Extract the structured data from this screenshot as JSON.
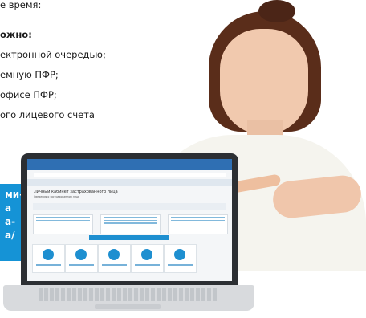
{
  "text_lines": [
    {
      "text": "е время:",
      "bold": false
    },
    {
      "text": "ожно:",
      "bold": true
    },
    {
      "text": "ектронной очередью;",
      "bold": false
    },
    {
      "text": "емную ПФР;",
      "bold": false
    },
    {
      "text": "офисе ПФР;",
      "bold": false
    },
    {
      "text": "ого лицевого счета",
      "bold": false
    }
  ],
  "blue_callout_lines": [
    "ми-",
    "а",
    "а-",
    "а/"
  ],
  "screen": {
    "title": "Личный кабинет застрахованного лица",
    "subtitle": "Сведения о застрахованном лице"
  },
  "colors": {
    "accent": "#1593d6",
    "sweater": "#f5f4ee",
    "laptop": "#2c2f33"
  }
}
